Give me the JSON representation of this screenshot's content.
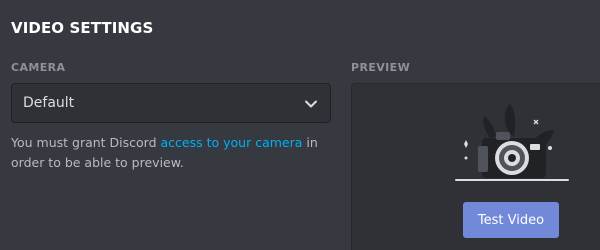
{
  "header": {
    "title": "VIDEO SETTINGS"
  },
  "camera": {
    "label": "CAMERA",
    "selected": "Default",
    "help_prefix": "You must grant Discord ",
    "help_link": "access to your camera",
    "help_suffix": " in order to be able to preview."
  },
  "preview": {
    "label": "PREVIEW",
    "test_button": "Test Video"
  },
  "colors": {
    "background": "#36393f",
    "panel": "#2f3136",
    "accent": "#7289da",
    "link": "#00b0f4"
  },
  "icons": {
    "dropdown": "chevron-down-icon",
    "illustration": "camera-illustration"
  }
}
